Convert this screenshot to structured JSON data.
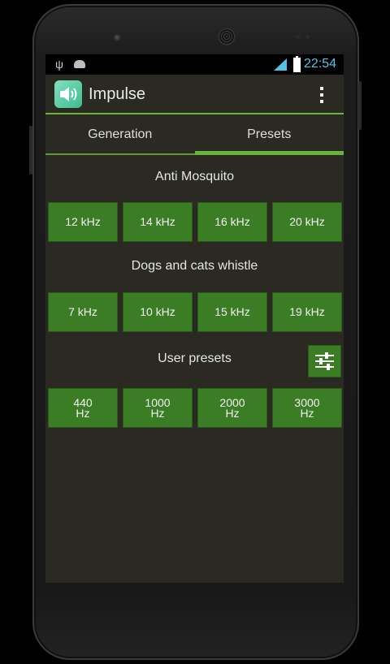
{
  "status_bar": {
    "time": "22:54",
    "usb_icon": "usb-icon",
    "android_icon": "android-debug-icon",
    "signal_icon": "signal-icon",
    "battery_icon": "battery-charging-icon"
  },
  "app": {
    "title": "Impulse",
    "icon": "speaker-icon",
    "menu_icon": "overflow-menu-icon",
    "accent": "#6ab43a",
    "button_color": "#3b7d25"
  },
  "tabs": [
    {
      "label": "Generation",
      "selected": false
    },
    {
      "label": "Presets",
      "selected": true
    }
  ],
  "sections": {
    "anti_mosquito": {
      "title": "Anti Mosquito",
      "buttons": [
        "12 kHz",
        "14 kHz",
        "16 kHz",
        "20 kHz"
      ]
    },
    "dogs_cats": {
      "title": "Dogs and cats whistle",
      "buttons": [
        "7 kHz",
        "10 kHz",
        "15 kHz",
        "19 kHz"
      ]
    },
    "user_presets": {
      "title": "User presets",
      "settings_icon": "equalizer-sliders-icon",
      "buttons": [
        "440\nHz",
        "1000\nHz",
        "2000\nHz",
        "3000\nHz"
      ]
    }
  }
}
